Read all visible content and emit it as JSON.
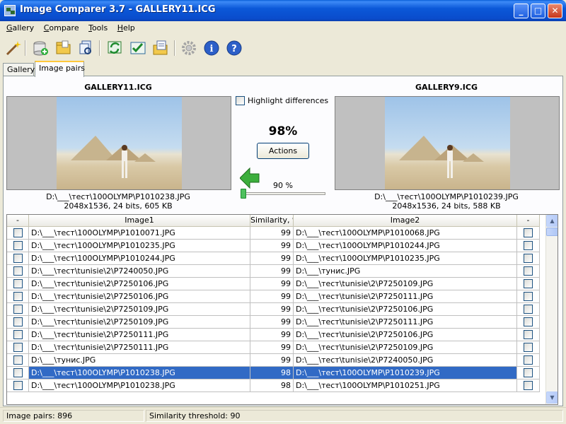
{
  "window": {
    "title": "Image Comparer 3.7 - GALLERY11.ICG",
    "minimize": "_",
    "maximize": "□",
    "close": "✕"
  },
  "menu": [
    {
      "label": "Gallery"
    },
    {
      "label": "Compare"
    },
    {
      "label": "Tools"
    },
    {
      "label": "Help"
    }
  ],
  "toolbar": [
    "magic-wand",
    "add-to-gallery",
    "open-folder",
    "find-duplicates",
    "refresh-compare",
    "mark-pairs",
    "export",
    "settings",
    "info",
    "help"
  ],
  "tabs": [
    {
      "label": "Gallery"
    },
    {
      "label": "Image pairs"
    }
  ],
  "compare": {
    "left": {
      "gallery": "GALLERY11.ICG",
      "path": "D:\\___\\тест\\100OLYMP\\P1010238.JPG",
      "info": "2048x1536, 24 bits, 605 KB"
    },
    "right": {
      "gallery": "GALLERY9.ICG",
      "path": "D:\\___\\тест\\100OLYMP\\P1010239.JPG",
      "info": "2048x1536, 24 bits, 588 KB"
    },
    "highlight_label": "Highlight differences",
    "similarity": "98%",
    "actions_label": "Actions",
    "threshold_label": "90 %",
    "threshold_value": 0.0
  },
  "grid": {
    "headers": [
      "-",
      "Image1",
      "Similarity, %",
      "Image2",
      "-"
    ],
    "rows": [
      {
        "image1": "D:\\___\\тест\\100OLYMP\\P1010071.JPG",
        "sim": "99",
        "image2": "D:\\___\\тест\\100OLYMP\\P1010068.JPG"
      },
      {
        "image1": "D:\\___\\тест\\100OLYMP\\P1010235.JPG",
        "sim": "99",
        "image2": "D:\\___\\тест\\100OLYMP\\P1010244.JPG"
      },
      {
        "image1": "D:\\___\\тест\\100OLYMP\\P1010244.JPG",
        "sim": "99",
        "image2": "D:\\___\\тест\\100OLYMP\\P1010235.JPG"
      },
      {
        "image1": "D:\\___\\тест\\tunisie\\2\\P7240050.JPG",
        "sim": "99",
        "image2": "D:\\___\\тунис.JPG"
      },
      {
        "image1": "D:\\___\\тест\\tunisie\\2\\P7250106.JPG",
        "sim": "99",
        "image2": "D:\\___\\тест\\tunisie\\2\\P7250109.JPG"
      },
      {
        "image1": "D:\\___\\тест\\tunisie\\2\\P7250106.JPG",
        "sim": "99",
        "image2": "D:\\___\\тест\\tunisie\\2\\P7250111.JPG"
      },
      {
        "image1": "D:\\___\\тест\\tunisie\\2\\P7250109.JPG",
        "sim": "99",
        "image2": "D:\\___\\тест\\tunisie\\2\\P7250106.JPG"
      },
      {
        "image1": "D:\\___\\тест\\tunisie\\2\\P7250109.JPG",
        "sim": "99",
        "image2": "D:\\___\\тест\\tunisie\\2\\P7250111.JPG"
      },
      {
        "image1": "D:\\___\\тест\\tunisie\\2\\P7250111.JPG",
        "sim": "99",
        "image2": "D:\\___\\тест\\tunisie\\2\\P7250106.JPG"
      },
      {
        "image1": "D:\\___\\тест\\tunisie\\2\\P7250111.JPG",
        "sim": "99",
        "image2": "D:\\___\\тест\\tunisie\\2\\P7250109.JPG"
      },
      {
        "image1": "D:\\___\\тунис.JPG",
        "sim": "99",
        "image2": "D:\\___\\тест\\tunisie\\2\\P7240050.JPG"
      },
      {
        "image1": "D:\\___\\тест\\100OLYMP\\P1010238.JPG",
        "sim": "98",
        "image2": "D:\\___\\тест\\100OLYMP\\P1010239.JPG",
        "selected": true
      },
      {
        "image1": "D:\\___\\тест\\100OLYMP\\P1010238.JPG",
        "sim": "98",
        "image2": "D:\\___\\тест\\100OLYMP\\P1010251.JPG"
      }
    ]
  },
  "status": {
    "pairs": "Image pairs: 896",
    "threshold": "Similarity threshold: 90"
  },
  "colors": {
    "title_bar": "#0a4ccc",
    "selection": "#316ac5",
    "slider_thumb": "#4ec05d",
    "arrow": "#3cae3c"
  }
}
